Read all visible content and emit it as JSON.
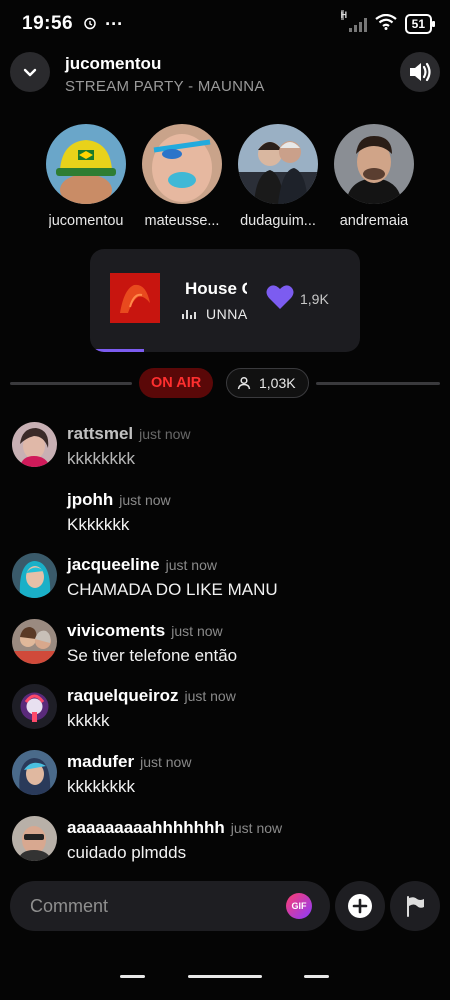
{
  "status_bar": {
    "time": "19:56",
    "alarm_icon": "alarm-icon",
    "more": "···",
    "network": "H",
    "battery": "51"
  },
  "header": {
    "title": "jucomentou",
    "subtitle": "STREAM PARTY - MAUNNA"
  },
  "listeners": [
    {
      "name": "jucomentou"
    },
    {
      "name": "mateusse..."
    },
    {
      "name": "dudaguim..."
    },
    {
      "name": "andremaia"
    }
  ],
  "now_playing": {
    "song": "House C",
    "artist": "UNNA",
    "likes": "1,9K",
    "progress": 0.2,
    "accent": "#7c5cf0"
  },
  "live": {
    "on_air": "ON AIR",
    "viewers": "1,03K"
  },
  "comments": [
    {
      "user": "rattsmel",
      "time": "just now",
      "text": "kkkkkkkk"
    },
    {
      "user": "jpohh",
      "time": "just now",
      "text": "Kkkkkkk"
    },
    {
      "user": "jacqueeline",
      "time": "just now",
      "text": "CHAMADA DO LIKE MANU"
    },
    {
      "user": "vivicoments",
      "time": "just now",
      "text": "Se tiver telefone então"
    },
    {
      "user": "raquelqueiroz",
      "time": "just now",
      "text": "kkkkk"
    },
    {
      "user": "madufer",
      "time": "just now",
      "text": "kkkkkkkk"
    },
    {
      "user": "aaaaaaaaahhhhhhh",
      "time": "just now",
      "text": "cuidado plmdds"
    }
  ],
  "composer": {
    "placeholder": "Comment",
    "gif_label": "GIF"
  }
}
